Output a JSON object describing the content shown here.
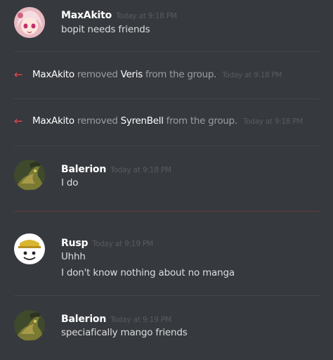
{
  "messages": [
    {
      "author": "MaxAkito",
      "timestamp": "Today at 9:18 PM",
      "lines": [
        "bopit needs friends"
      ],
      "avatar_icon": "anime-girl-avatar"
    },
    {
      "author": "Balerion",
      "timestamp": "Today at 9:18 PM",
      "lines": [
        "I do"
      ],
      "avatar_icon": "dragon-avatar"
    },
    {
      "author": "Rusp",
      "timestamp": "Today at 9:19 PM",
      "lines": [
        "Uhhh",
        "I don't know nothing about no manga"
      ],
      "avatar_icon": "cartoon-face-avatar"
    },
    {
      "author": "Balerion",
      "timestamp": "Today at 9:19 PM",
      "lines": [
        "speciafically mango friends"
      ],
      "avatar_icon": "dragon-avatar"
    }
  ],
  "system_events": [
    {
      "actor": "MaxAkito",
      "verb": "removed",
      "target": "Veris",
      "suffix": "from the group.",
      "timestamp": "Today at 9:18 PM",
      "icon": "leave-arrow-icon"
    },
    {
      "actor": "MaxAkito",
      "verb": "removed",
      "target": "SyrenBell",
      "suffix": "from the group.",
      "timestamp": "Today at 9:18 PM",
      "icon": "leave-arrow-icon"
    }
  ],
  "colors": {
    "background": "#36393e",
    "divider": "#43464b",
    "new_messages_divider": "#6a3a3d",
    "removed_arrow": "#f04747"
  }
}
